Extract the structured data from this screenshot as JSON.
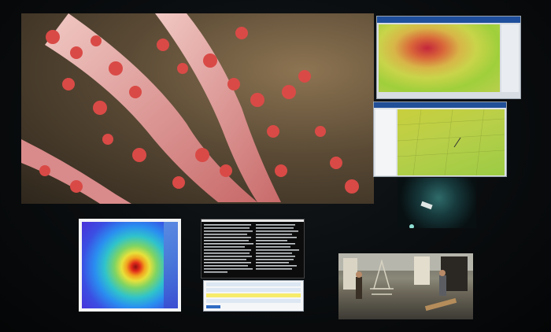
{
  "screens": {
    "coral_video": {
      "icon": "coral-video-feed"
    },
    "bathymetry_top": {
      "icon": "bathymetry-map",
      "colors": [
        "#c4263b",
        "#d8b548",
        "#9fcf3b"
      ]
    },
    "bathymetry_bottom": {
      "icon": "bathymetry-grid-map"
    },
    "rov_video": {
      "icon": "rov-camera-feed"
    },
    "heat_map": {
      "icon": "sonar-heat-map",
      "colors": [
        "#8c1010",
        "#f2a21e",
        "#2fc3cc",
        "#3b4fe3"
      ]
    },
    "terminal": {
      "icon": "terminal-window"
    },
    "message_window": {
      "icon": "message-form-window"
    },
    "deck_camera": {
      "icon": "ship-deck-camera"
    }
  }
}
